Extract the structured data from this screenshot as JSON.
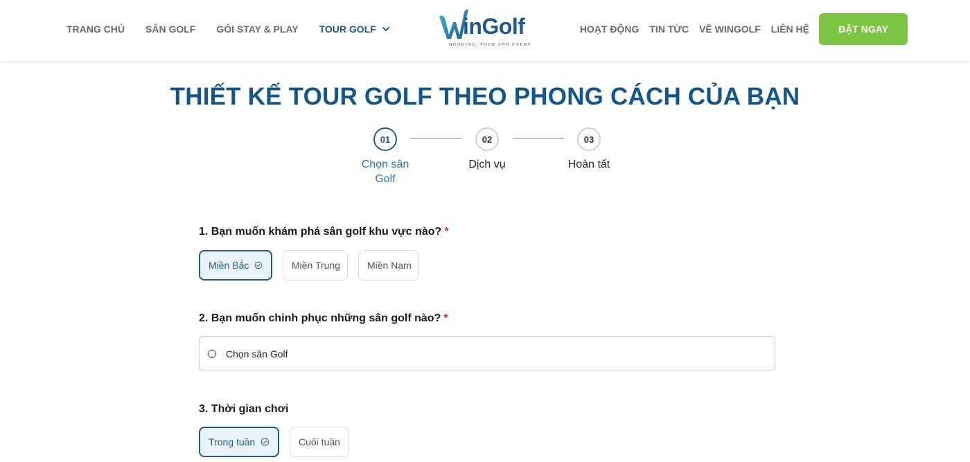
{
  "header": {
    "nav_left": [
      "TRANG CHỦ",
      "SÂN GOLF",
      "GÓI STAY & PLAY",
      "TOUR GOLF"
    ],
    "nav_right": [
      "HOẠT ĐỘNG",
      "TIN TỨC",
      "VỀ WINGOLF",
      "LIÊN HỆ"
    ],
    "logo_text": "inGolf",
    "logo_tagline": "BOOKING, TOUR AND EVENT",
    "cta_label": "ĐẶT NGAY",
    "active_nav": "TOUR GOLF"
  },
  "title": "THIẾT KẾ TOUR GOLF THEO PHONG CÁCH CỦA BẠN",
  "steps": [
    {
      "number": "01",
      "label": "Chọn sân Golf",
      "active": true
    },
    {
      "number": "02",
      "label": "Dịch vụ",
      "active": false
    },
    {
      "number": "03",
      "label": "Hoàn tất",
      "active": false
    }
  ],
  "questions": {
    "q1": {
      "label": "1. Bạn muốn khám phá sân golf khu vực nào?",
      "required": "*",
      "options": [
        "Miền Bắc",
        "Miền Trung",
        "Miền Nam"
      ],
      "selected": "Miền Bắc"
    },
    "q2": {
      "label": "2. Bạn muốn chinh phục những sân golf nào?",
      "required": "*",
      "placeholder": "Chọn sân Golf"
    },
    "q3": {
      "label": "3. Thời gian chơi",
      "options": [
        "Trong tuần",
        "Cuối tuần"
      ],
      "selected": "Trong tuần"
    }
  },
  "colors": {
    "brand_blue": "#1f5a8c",
    "title_blue": "#13568c",
    "cta_green": "#7dc443",
    "required_red": "#e0262b",
    "selected_bg": "#eaf3fb"
  }
}
